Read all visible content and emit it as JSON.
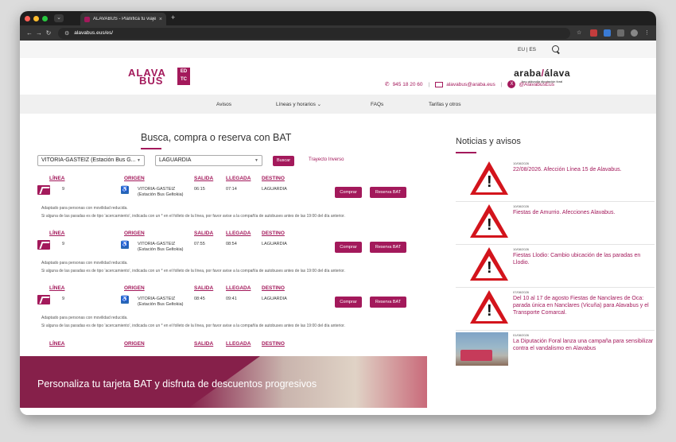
{
  "browser": {
    "tab_title": "ALAVABUS - Planifica tu viaje",
    "tab_close": "×",
    "new_tab": "+",
    "url": "alavabus.eus/es/",
    "back": "←",
    "forward": "→",
    "reload": "↻",
    "tab_chevron": "⌄"
  },
  "topbar": {
    "lang": "EU | ES"
  },
  "logos": {
    "alava_line1": "ALAVA",
    "alava_line2": "BUS",
    "ctc": "ED TC",
    "araba_left": "araba",
    "araba_right": "álava",
    "araba_sub": "foru aldundia  diputación foral"
  },
  "contact": {
    "phone": "945 18 20 60",
    "email": "alavabus@araba.eus",
    "twitter": "@AlavabusEus",
    "sep": "|"
  },
  "menu": [
    "Avisos",
    "Líneas y horarios ⌄",
    "FAQs",
    "Tarifas y otros"
  ],
  "search": {
    "heading": "Busca, compra o reserva con BAT",
    "origin": "VITORIA-GASTEIZ (Estación Bus G...",
    "destination": "LAGUARDIA",
    "search_button": "Buscar",
    "reverse_link": "Trayecto Inverso"
  },
  "columns": {
    "line": "LÍNEA",
    "origin": "ORIGEN",
    "departure": "SALIDA",
    "arrival": "LLEGADA",
    "destination": "DESTINO"
  },
  "results": [
    {
      "line": "9",
      "origin": "VITORIA-GASTEIZ",
      "origin_sub": "(Estación Bus Geltokia)",
      "departure": "06:15",
      "arrival": "07:14",
      "destination": "LAGUARDIA"
    },
    {
      "line": "9",
      "origin": "VITORIA-GASTEIZ",
      "origin_sub": "(Estación Bus Geltokia)",
      "departure": "07:55",
      "arrival": "08:54",
      "destination": "LAGUARDIA"
    },
    {
      "line": "9",
      "origin": "VITORIA-GASTEIZ",
      "origin_sub": "(Estación Bus Geltokia)",
      "departure": "08:45",
      "arrival": "09:41",
      "destination": "LAGUARDIA"
    }
  ],
  "result_buttons": {
    "buy": "Comprar",
    "reserve": "Reserva BAT"
  },
  "notes": {
    "adapted": "Adaptado para personas con movilidad reducida.",
    "warning": "Si alguna de las paradas es de tipo 'acercamiento', indicada con un * en el folleto de la línea, por favor avise a la compañía de autobuses antes de las 19:00 del día anterior."
  },
  "promo": {
    "text": "Personaliza tu tarjeta BAT y disfruta de descuentos progresivos"
  },
  "news": {
    "heading": "Noticias y avisos",
    "items": [
      {
        "date": "10/08/2026",
        "title": "22/08/2026. Afección Línea 15 de Alavabus.",
        "image": "warning-sign"
      },
      {
        "date": "10/08/2026",
        "title": "Fiestas de Amurrio. Afecciones Alavabus.",
        "image": "warning-sign"
      },
      {
        "date": "10/08/2026",
        "title": "Fiestas Llodio: Cambio ubicación de las paradas en Llodio.",
        "image": "warning-sign"
      },
      {
        "date": "07/08/2026",
        "title": "Del 10 al 17 de agosto Fiestas de Nanclares de Oca: parada única en Nanclares (Vicuña) para Alavabus y el Transporte Comarcal.",
        "image": "warning-sign"
      },
      {
        "date": "01/08/2026",
        "title": "La Diputación Foral lanza una campaña para sensibilizar contra el vandalismo en Alavabus",
        "image": "bus-photo"
      }
    ]
  },
  "colors": {
    "brand": "#a3195b",
    "warning_red": "#d3141c"
  }
}
